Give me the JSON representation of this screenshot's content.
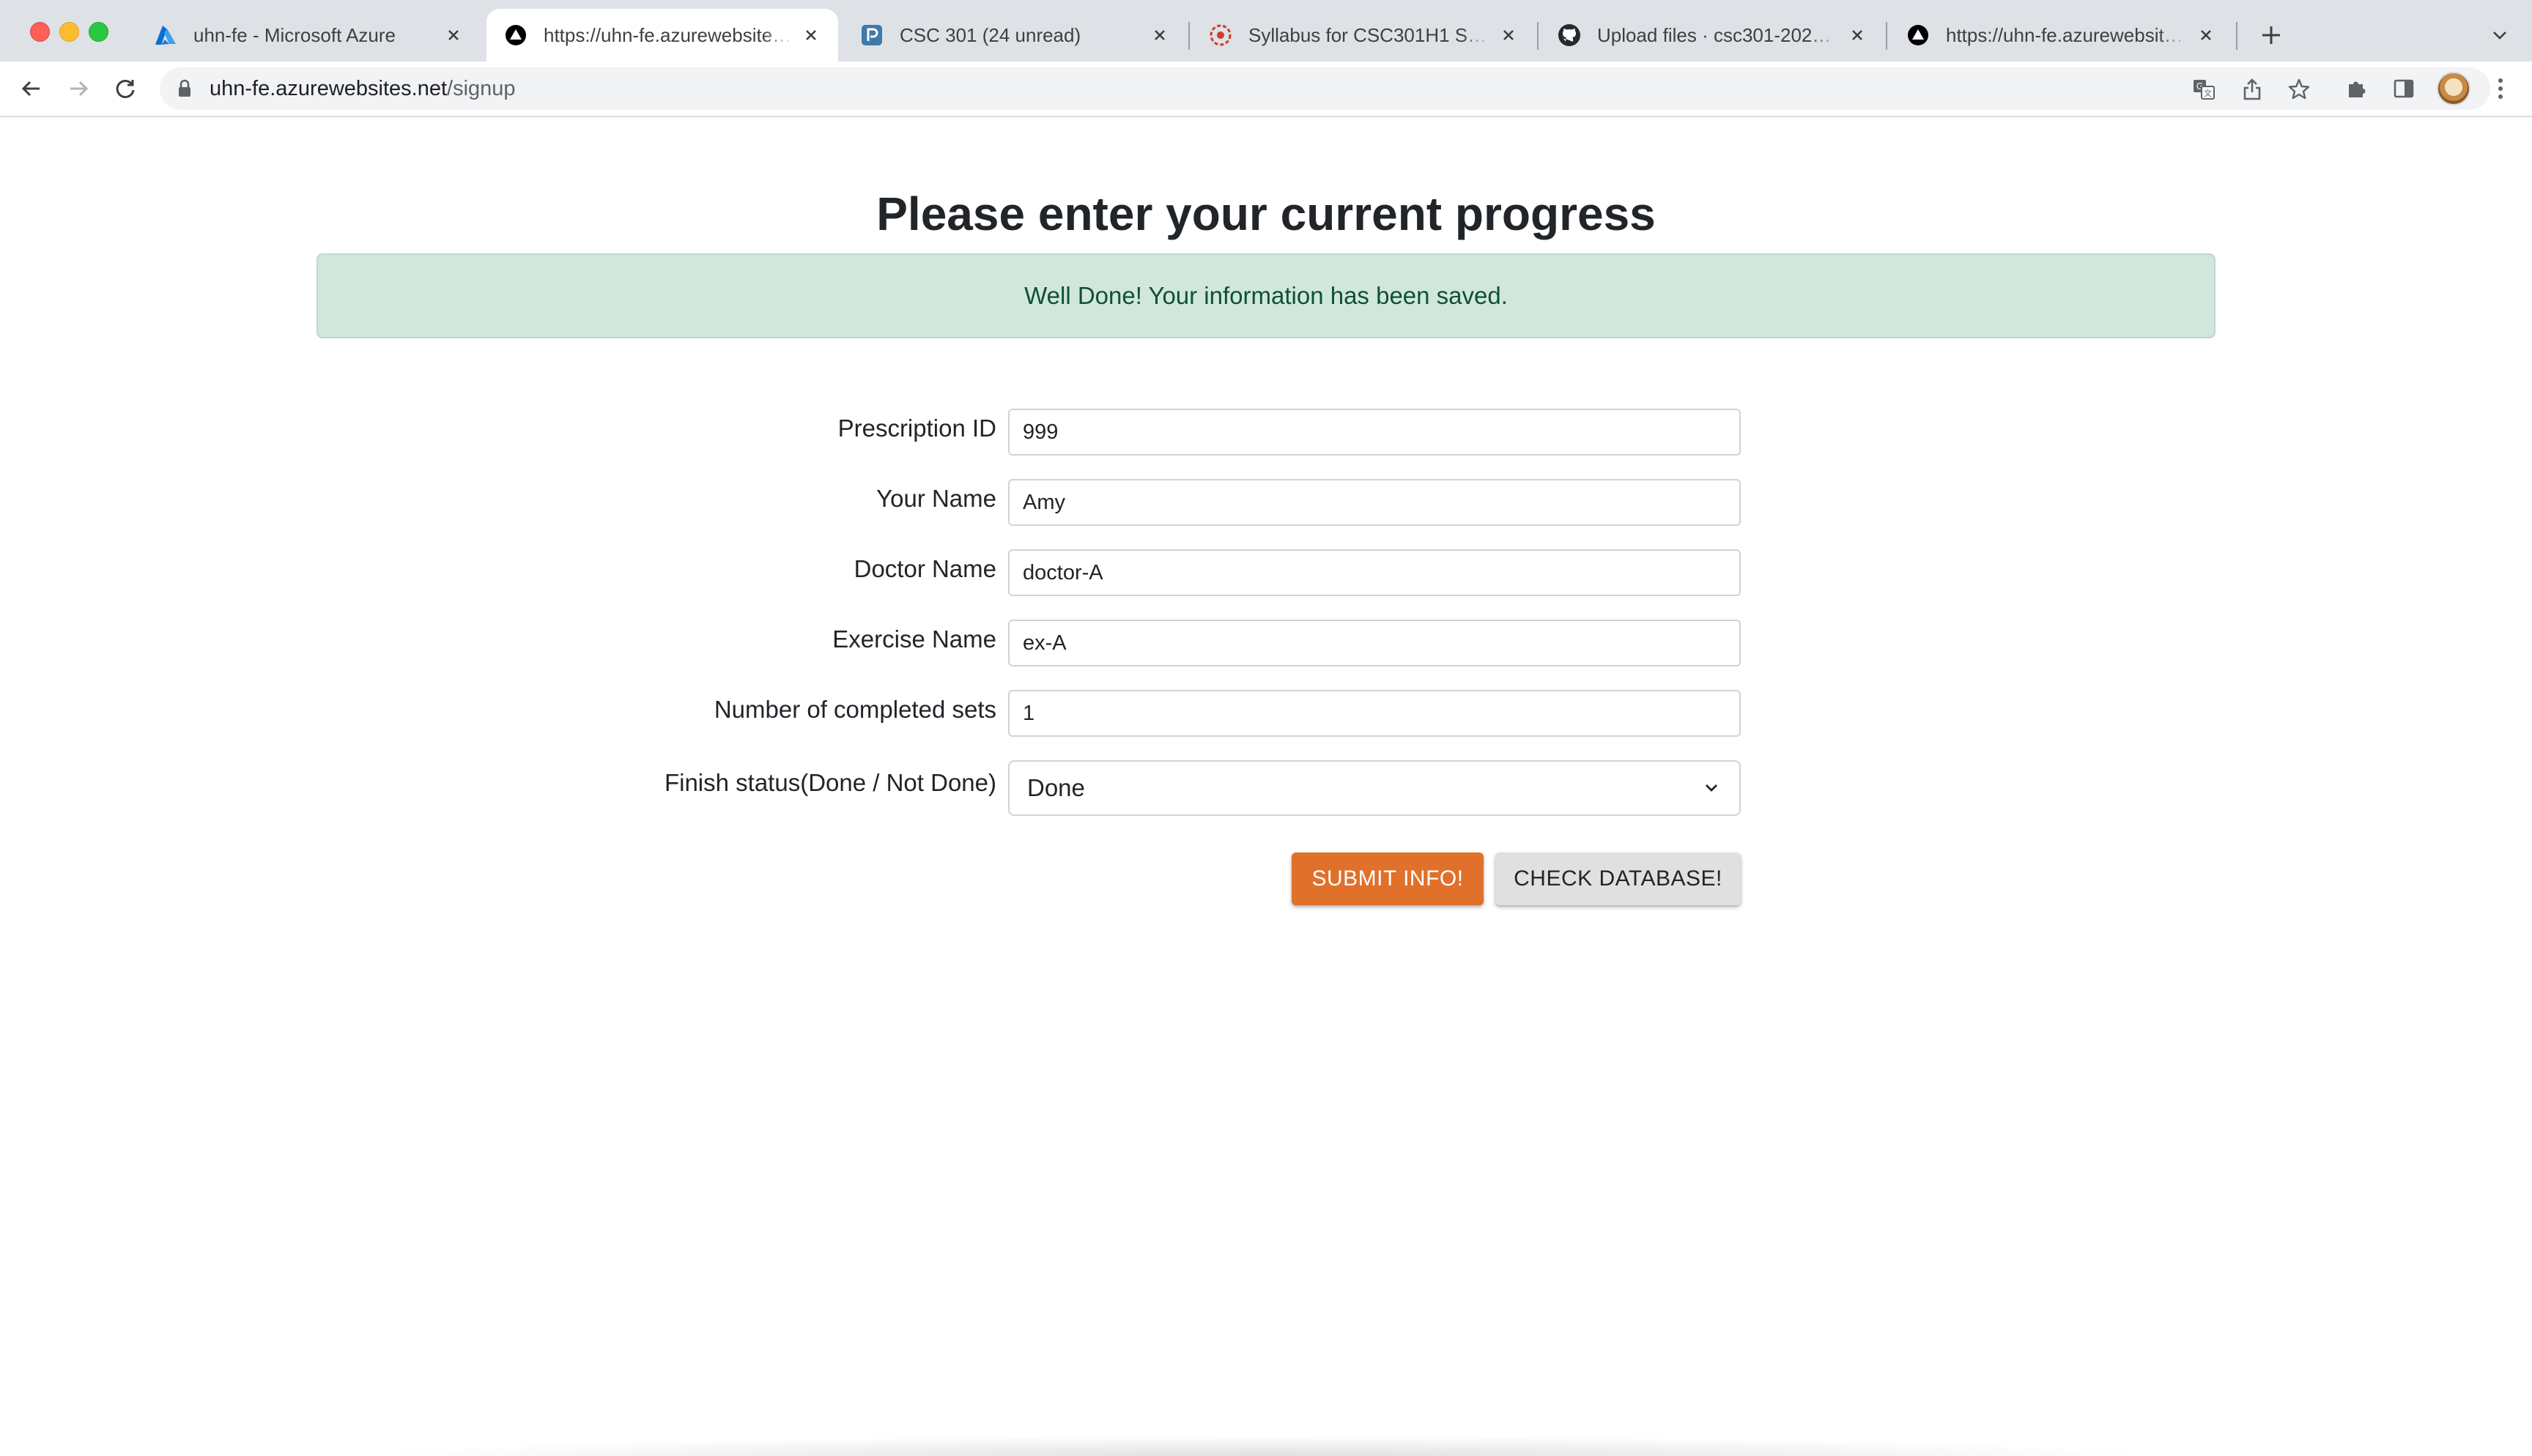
{
  "browser": {
    "tabs": [
      {
        "title": "uhn-fe - Microsoft Azure",
        "icon": "azure-icon",
        "active": false
      },
      {
        "title": "https://uhn-fe.azurewebsites.net",
        "icon": "triangle-favicon-icon",
        "active": true
      },
      {
        "title": "CSC 301 (24 unread)",
        "icon": "piazza-icon",
        "active": false
      },
      {
        "title": "Syllabus for CSC301H1 S LEC5101",
        "icon": "quercus-icon",
        "active": false
      },
      {
        "title": "Upload files · csc301-2023-winter",
        "icon": "github-icon",
        "active": false
      },
      {
        "title": "https://uhn-fe.azurewebsites.net",
        "icon": "triangle-favicon-icon",
        "active": false
      }
    ],
    "address": {
      "host": "uhn-fe.azurewebsites.net",
      "path": "/signup"
    }
  },
  "page": {
    "heading": "Please enter your current progress",
    "alert": "Well Done! Your information has been saved.",
    "fields": [
      {
        "label": "Prescription ID",
        "value": "999"
      },
      {
        "label": "Your Name",
        "value": "Amy"
      },
      {
        "label": "Doctor Name",
        "value": "doctor-A"
      },
      {
        "label": "Exercise Name",
        "value": "ex-A"
      },
      {
        "label": "Number of completed sets",
        "value": "1"
      }
    ],
    "status": {
      "label": "Finish status(Done / Not Done)",
      "value": "Done"
    },
    "buttons": {
      "submit": "SUBMIT INFO!",
      "check": "CHECK DATABASE!"
    }
  },
  "colors": {
    "submit_button": "#e0702a",
    "alert_bg": "#d1e7dd",
    "alert_text": "#0f5132"
  }
}
